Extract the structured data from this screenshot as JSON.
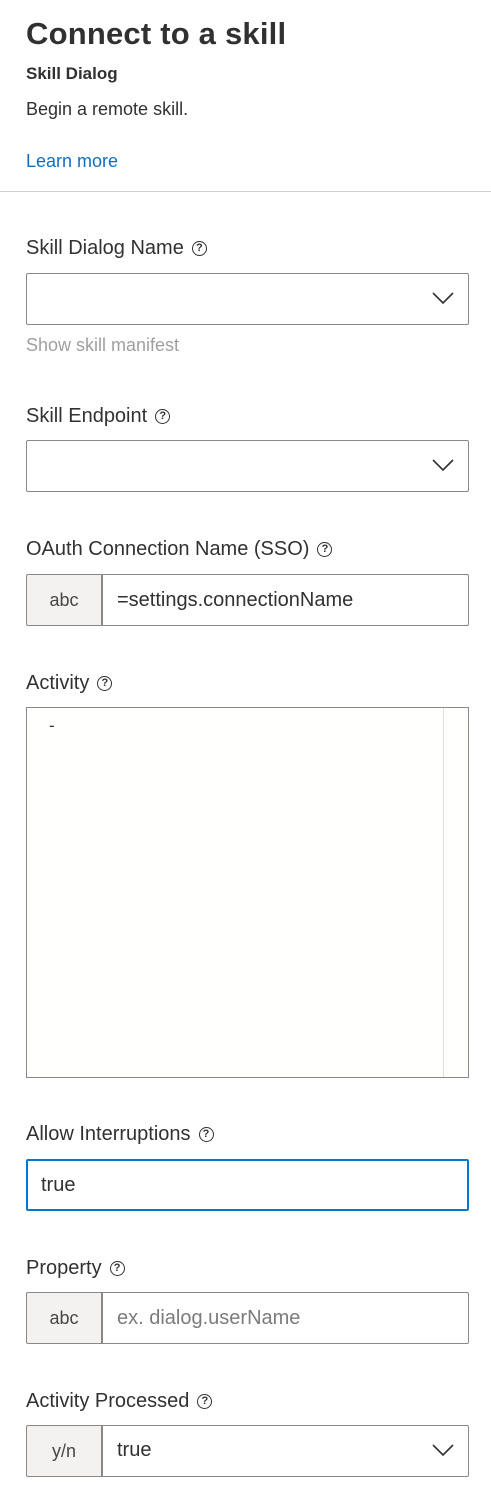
{
  "header": {
    "title": "Connect to a skill",
    "subtitle": "Skill Dialog",
    "description": "Begin a remote skill.",
    "learn_more": "Learn more"
  },
  "fields": {
    "skill_dialog_name": {
      "label": "Skill Dialog Name",
      "value": "",
      "hint": "Show skill manifest"
    },
    "skill_endpoint": {
      "label": "Skill Endpoint",
      "value": ""
    },
    "oauth_connection": {
      "label": "OAuth Connection Name (SSO)",
      "type_badge": "abc",
      "value": "=settings.connectionName"
    },
    "activity": {
      "label": "Activity",
      "value": "-"
    },
    "allow_interruptions": {
      "label": "Allow Interruptions",
      "value": "true"
    },
    "property": {
      "label": "Property",
      "type_badge": "abc",
      "placeholder": "ex. dialog.userName",
      "value": ""
    },
    "activity_processed": {
      "label": "Activity Processed",
      "type_badge": "y/n",
      "value": "true"
    }
  },
  "icons": {
    "help": "question-circle-icon",
    "dropdown": "chevron-down-icon"
  },
  "colors": {
    "link": "#106ebe",
    "focus_border": "#0078d4",
    "hint_text": "#a19f9d",
    "badge_bg": "#f3f2f1"
  }
}
